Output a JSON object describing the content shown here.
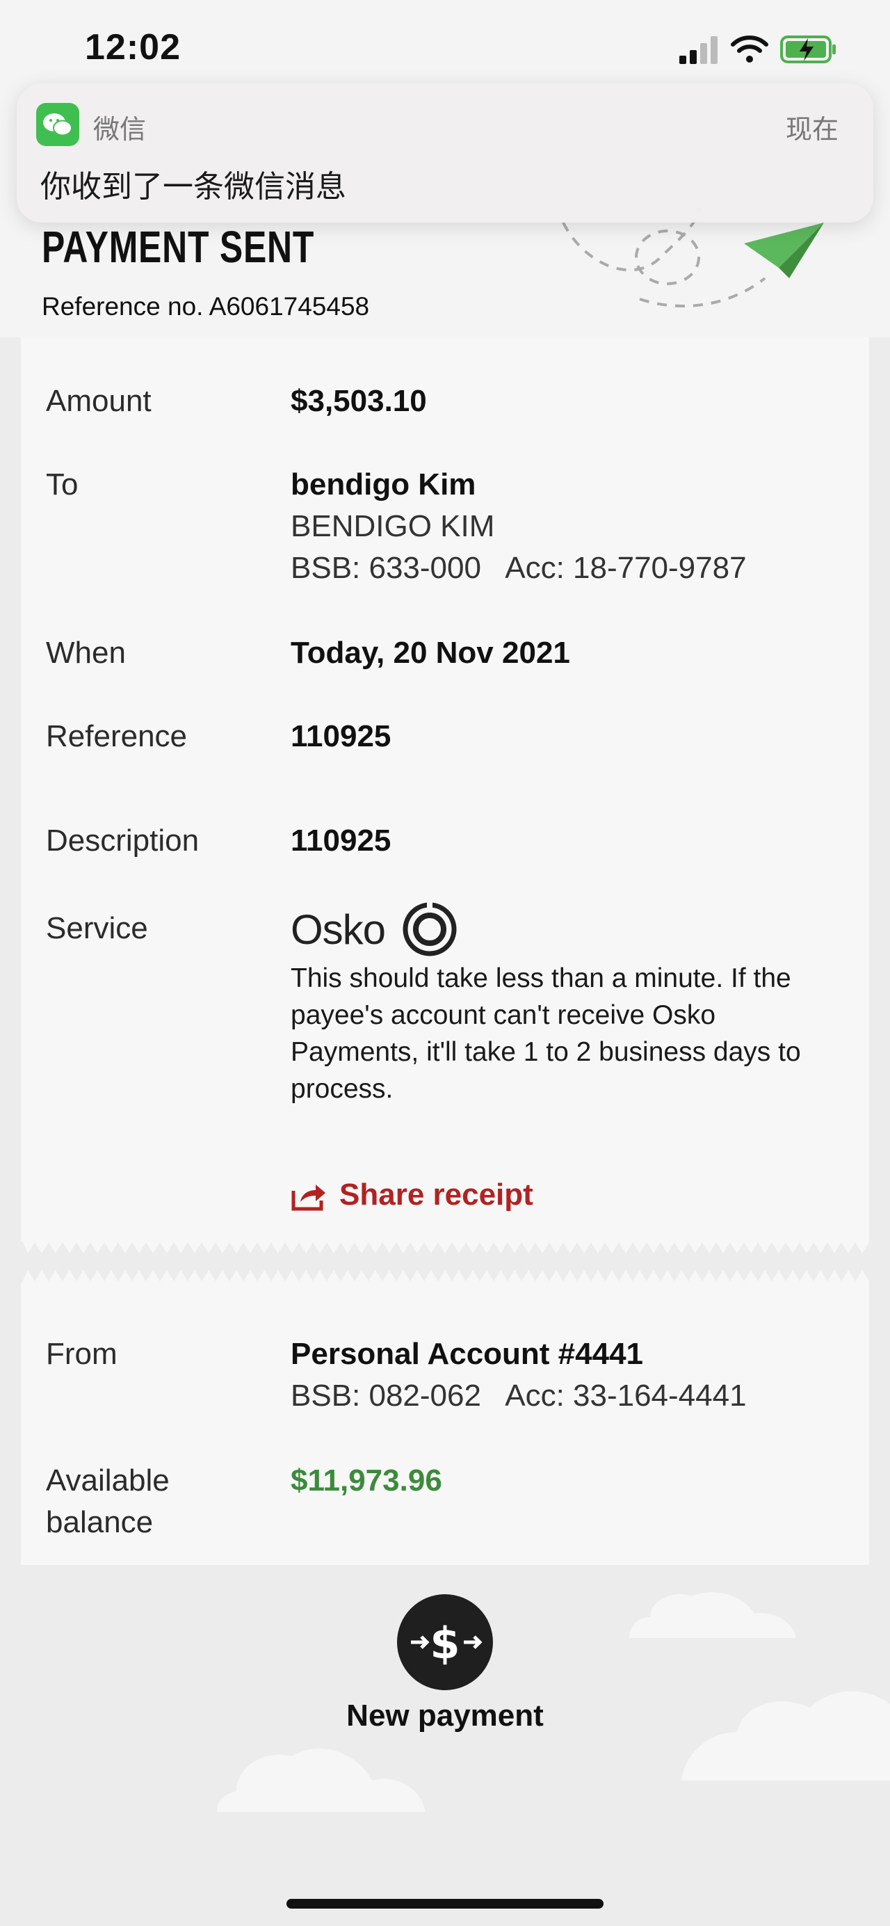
{
  "status_bar": {
    "time": "12:02"
  },
  "notification": {
    "app": "微信",
    "time": "现在",
    "message": "你收到了一条微信消息"
  },
  "header": {
    "title": "PAYMENT SENT",
    "reference_no": "Reference no. A6061745458"
  },
  "details": {
    "amount_label": "Amount",
    "amount": "$3,503.10",
    "to_label": "To",
    "to_name": "bendigo Kim",
    "to_name_upper": "BENDIGO KIM",
    "to_bank": "BSB: 633-000   Acc: 18-770-9787",
    "when_label": "When",
    "when": "Today, 20 Nov 2021",
    "reference_label": "Reference",
    "reference": "110925",
    "description_label": "Description",
    "description": "110925",
    "service_label": "Service",
    "service_name": "Osko",
    "service_desc": "This should take less than a minute. If the payee's account can't receive Osko Payments, it'll take 1 to 2 business days to process.",
    "share_label": "Share receipt"
  },
  "from": {
    "from_label": "From",
    "account": "Personal Account #4441",
    "bank": "BSB: 082-062   Acc: 33-164-4441",
    "balance_label_1": "Available",
    "balance_label_2": "balance",
    "balance": "$11,973.96"
  },
  "actions": {
    "new_payment": "New payment"
  },
  "colors": {
    "accent_red": "#b22222",
    "balance_green": "#3d8a3d",
    "wechat_green": "#3fbf50"
  }
}
